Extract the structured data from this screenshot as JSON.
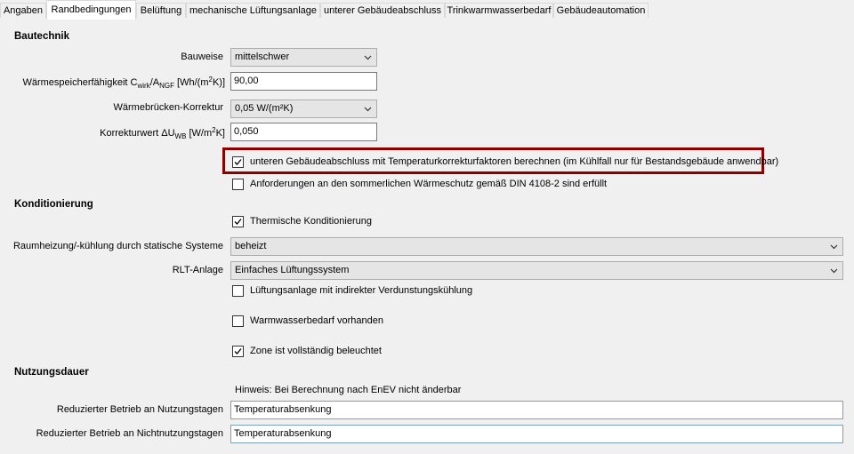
{
  "tabs": [
    {
      "label": "Angaben"
    },
    {
      "label": "Randbedingungen"
    },
    {
      "label": "Belüftung"
    },
    {
      "label": "mechanische Lüftungsanlage"
    },
    {
      "label": "unterer Gebäudeabschluss"
    },
    {
      "label": "Trinkwarmwasserbedarf"
    },
    {
      "label": "Gebäudeautomation"
    }
  ],
  "active_tab": "Randbedingungen",
  "sections": {
    "bautechnik": "Bautechnik",
    "konditionierung": "Konditionierung",
    "nutzungsdauer": "Nutzungsdauer"
  },
  "bautechnik": {
    "bauweise_label": "Bauweise",
    "bauweise_value": "mittelschwer",
    "waerme_label_pre": "Wärmespeicherfähigkeit C",
    "waerme_sub1": "wirk",
    "waerme_mid": "/A",
    "waerme_sub2": "NGF",
    "waerme_unit_pre": " [Wh/(m",
    "waerme_sup": "2",
    "waerme_unit_post": "K)]",
    "waerme_value": "90,00",
    "wbk_label": "Wärmebrücken-Korrektur",
    "wbk_value": "0,05 W/(m²K)",
    "korr_label_pre": "Korrekturwert ΔU",
    "korr_sub": "WB",
    "korr_unit_pre": " [W/m",
    "korr_sup": "2",
    "korr_unit_post": "K]",
    "korr_value": "0,050",
    "check_temp_korr": "unteren Gebäudeabschluss mit Temperaturkorrekturfaktoren berechnen (im Kühlfall nur für Bestandsgebäude anwendbar)",
    "check_temp_korr_checked": true,
    "check_sommer": "Anforderungen an den sommerlichen Wärmeschutz gemäß DIN 4108-2 sind erfüllt",
    "check_sommer_checked": false
  },
  "konditionierung": {
    "check_thermisch": "Thermische Konditionierung",
    "check_thermisch_checked": true,
    "raum_label": "Raumheizung/-kühlung durch statische Systeme",
    "raum_value": "beheizt",
    "rlt_label": "RLT-Anlage",
    "rlt_value": "Einfaches Lüftungssystem",
    "check_verdunstung": "Lüftungsanlage mit indirekter Verdunstungskühlung",
    "check_verdunstung_checked": false,
    "check_warmwasser": "Warmwasserbedarf vorhanden",
    "check_warmwasser_checked": false,
    "check_beleuchtet": "Zone ist vollständig beleuchtet",
    "check_beleuchtet_checked": true
  },
  "nutzungsdauer": {
    "hinweis": "Hinweis: Bei Berechnung nach EnEV nicht änderbar",
    "nutzungstage_label": "Reduzierter Betrieb an Nutzungstagen",
    "nutzungstage_value": "Temperaturabsenkung",
    "nichtnutzungstage_label": "Reduzierter Betrieb an Nichtnutzungstagen",
    "nichtnutzungstage_value": "Temperaturabsenkung"
  },
  "colors": {
    "highlight": "#8b0000",
    "background": "#f0f0f0",
    "input_border_blue": "#7aa1b4"
  }
}
